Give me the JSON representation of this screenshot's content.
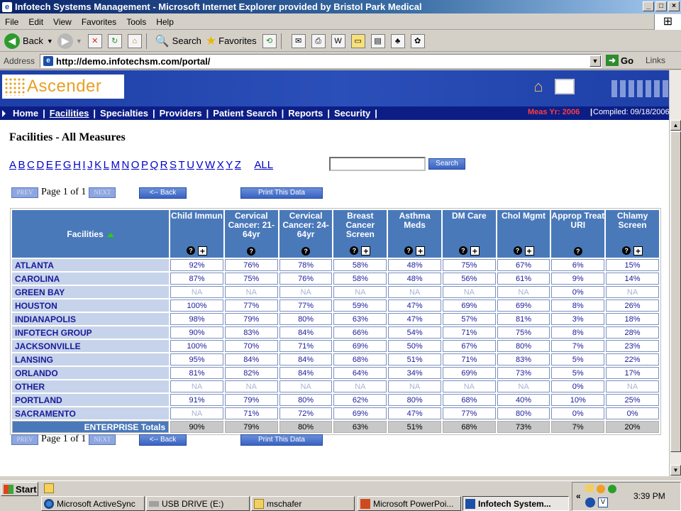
{
  "window": {
    "title": "Infotech Systems Management - Microsoft Internet Explorer provided by Bristol Park Medical"
  },
  "menu": [
    "File",
    "Edit",
    "View",
    "Favorites",
    "Tools",
    "Help"
  ],
  "toolbar": {
    "back": "Back",
    "search": "Search",
    "favorites": "Favorites"
  },
  "address": {
    "label": "Address",
    "url": "http://demo.infotechsm.com/portal/",
    "go": "Go",
    "links": "Links"
  },
  "app": {
    "logo": "Ascender"
  },
  "nav": {
    "items": [
      "Home",
      "Facilities",
      "Specialties",
      "Providers",
      "Patient Search",
      "Reports",
      "Security"
    ],
    "active": "Facilities",
    "meas_yr": "Meas Yr: 2006",
    "compiled": "Compiled: 09/18/2006"
  },
  "page": {
    "title": "Facilities - All Measures",
    "alphabet": [
      "A",
      "B",
      "C",
      "D",
      "E",
      "F",
      "G",
      "H",
      "I",
      "J",
      "K",
      "L",
      "M",
      "N",
      "O",
      "P",
      "Q",
      "R",
      "S",
      "T",
      "U",
      "V",
      "W",
      "X",
      "Y",
      "Z"
    ],
    "all_label": "ALL",
    "search_value": "",
    "search_button": "Search",
    "prev": "PREV",
    "next": "NEXT",
    "page_info": "Page 1 of 1",
    "back_button": "<-- Back",
    "print_button": "Print This Data"
  },
  "table": {
    "facilities_header": "Facilities",
    "columns": [
      {
        "label": "Child Immun",
        "q": true,
        "plus": true
      },
      {
        "label": "Cervical Cancer: 21-64yr",
        "q": true,
        "plus": false
      },
      {
        "label": "Cervical Cancer: 24-64yr",
        "q": true,
        "plus": false
      },
      {
        "label": "Breast Cancer Screen",
        "q": true,
        "plus": true
      },
      {
        "label": "Asthma Meds",
        "q": true,
        "plus": true
      },
      {
        "label": "DM Care",
        "q": true,
        "plus": true
      },
      {
        "label": "Chol Mgmt",
        "q": true,
        "plus": true
      },
      {
        "label": "Approp Treat URI",
        "q": true,
        "plus": false
      },
      {
        "label": "Chlamy Screen",
        "q": true,
        "plus": true
      }
    ],
    "rows": [
      {
        "name": "ATLANTA",
        "values": [
          "92%",
          "76%",
          "78%",
          "58%",
          "48%",
          "75%",
          "67%",
          "6%",
          "15%"
        ]
      },
      {
        "name": "CAROLINA",
        "values": [
          "87%",
          "75%",
          "76%",
          "58%",
          "48%",
          "56%",
          "61%",
          "9%",
          "14%"
        ]
      },
      {
        "name": "GREEN BAY",
        "values": [
          "NA",
          "NA",
          "NA",
          "NA",
          "NA",
          "NA",
          "NA",
          "0%",
          "NA"
        ]
      },
      {
        "name": "HOUSTON",
        "values": [
          "100%",
          "77%",
          "77%",
          "59%",
          "47%",
          "69%",
          "69%",
          "8%",
          "26%"
        ]
      },
      {
        "name": "INDIANAPOLIS",
        "values": [
          "98%",
          "79%",
          "80%",
          "63%",
          "47%",
          "57%",
          "81%",
          "3%",
          "18%"
        ]
      },
      {
        "name": "INFOTECH GROUP",
        "values": [
          "90%",
          "83%",
          "84%",
          "66%",
          "54%",
          "71%",
          "75%",
          "8%",
          "28%"
        ]
      },
      {
        "name": "JACKSONVILLE",
        "values": [
          "100%",
          "70%",
          "71%",
          "69%",
          "50%",
          "67%",
          "80%",
          "7%",
          "23%"
        ]
      },
      {
        "name": "LANSING",
        "values": [
          "95%",
          "84%",
          "84%",
          "68%",
          "51%",
          "71%",
          "83%",
          "5%",
          "22%"
        ]
      },
      {
        "name": "ORLANDO",
        "values": [
          "81%",
          "82%",
          "84%",
          "64%",
          "34%",
          "69%",
          "73%",
          "5%",
          "17%"
        ]
      },
      {
        "name": "OTHER",
        "values": [
          "NA",
          "NA",
          "NA",
          "NA",
          "NA",
          "NA",
          "NA",
          "0%",
          "NA"
        ]
      },
      {
        "name": "PORTLAND",
        "values": [
          "91%",
          "79%",
          "80%",
          "62%",
          "80%",
          "68%",
          "40%",
          "10%",
          "25%"
        ]
      },
      {
        "name": "SACRAMENTO",
        "values": [
          "NA",
          "71%",
          "72%",
          "69%",
          "47%",
          "77%",
          "80%",
          "0%",
          "0%"
        ]
      }
    ],
    "totals": {
      "label": "ENTERPRISE Totals",
      "values": [
        "90%",
        "79%",
        "80%",
        "63%",
        "51%",
        "68%",
        "73%",
        "7%",
        "20%"
      ]
    }
  },
  "taskbar": {
    "start": "Start",
    "tasks": [
      "Microsoft ActiveSync",
      "USB DRIVE (E:)",
      "mschafer",
      "Microsoft PowerPoi...",
      "Infotech System..."
    ],
    "active_task": "Infotech System...",
    "time": "3:39 PM"
  }
}
